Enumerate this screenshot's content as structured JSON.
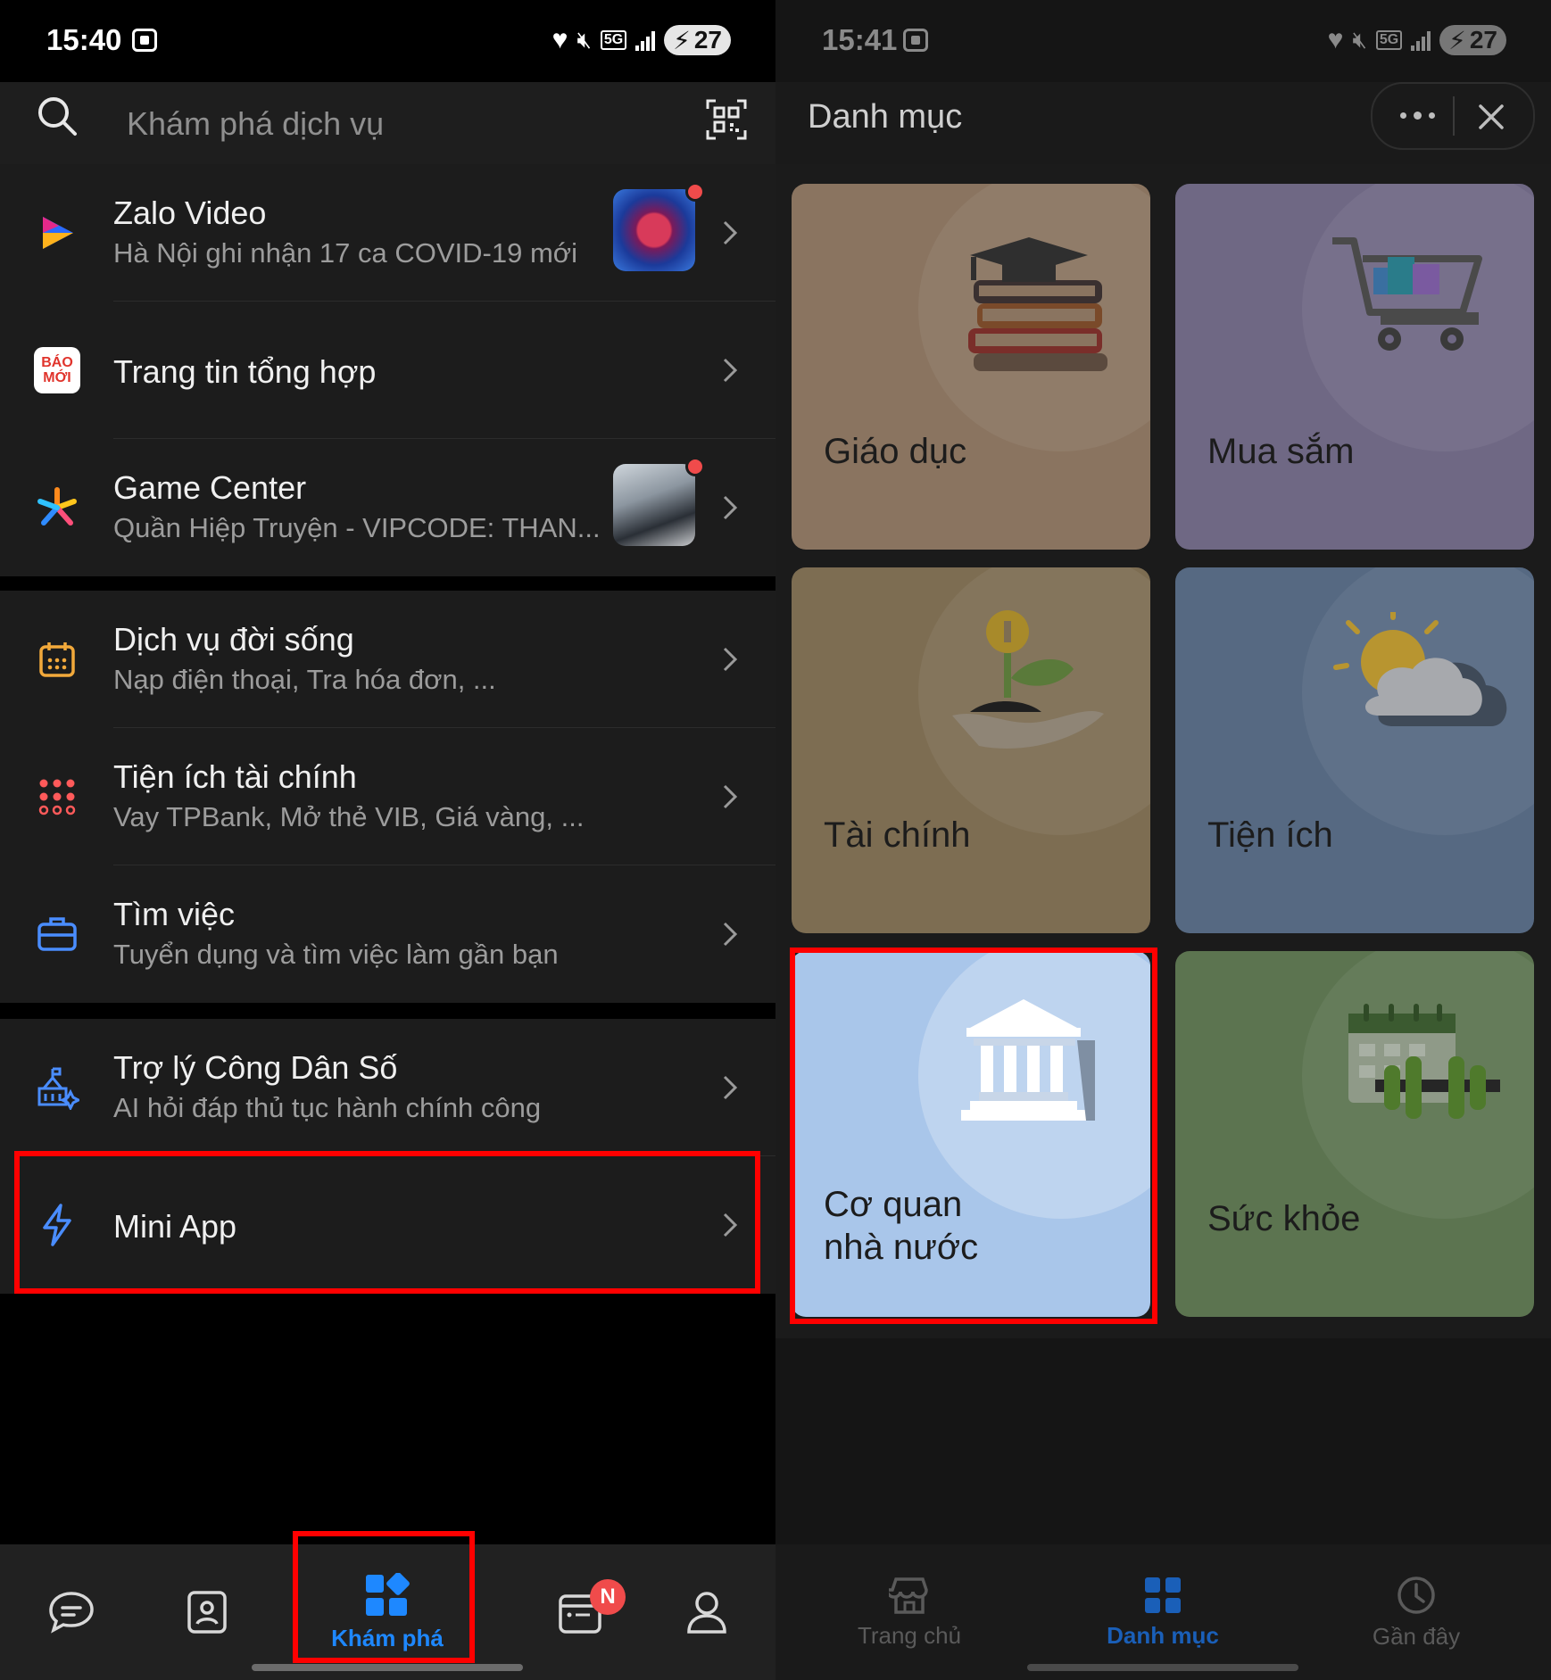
{
  "left_screen": {
    "status": {
      "time": "15:40",
      "battery": "27"
    },
    "search": {
      "placeholder": "Khám phá dịch vụ"
    },
    "items": [
      {
        "title": "Zalo Video",
        "subtitle": "Hà Nội ghi nhận 17 ca COVID-19 mới"
      },
      {
        "title": "Trang tin tổng hợp",
        "subtitle": ""
      },
      {
        "title": "Game Center",
        "subtitle": "Quần Hiệp Truyện - VIPCODE: THAN..."
      },
      {
        "title": "Dịch vụ đời sống",
        "subtitle": "Nạp điện thoại, Tra hóa đơn, ..."
      },
      {
        "title": "Tiện ích tài chính",
        "subtitle": "Vay TPBank, Mở thẻ VIB, Giá vàng, ..."
      },
      {
        "title": "Tìm việc",
        "subtitle": "Tuyển dụng và tìm việc làm gần bạn"
      },
      {
        "title": "Trợ lý Công Dân Số",
        "subtitle": "AI hỏi đáp thủ tục hành chính công"
      },
      {
        "title": "Mini App",
        "subtitle": ""
      }
    ],
    "baomoi_logo": [
      "BÁO",
      "MỚI"
    ],
    "bottom_nav": {
      "explore_label": "Khám phá",
      "badge": "N"
    }
  },
  "right_screen": {
    "status": {
      "time": "15:41",
      "battery": "27"
    },
    "header": {
      "title": "Danh mục"
    },
    "categories": [
      {
        "label": "Giáo dục",
        "color": "#8a7460"
      },
      {
        "label": "Mua sắm",
        "color": "#6f6884"
      },
      {
        "label": "Tài chính",
        "color": "#7d6d52"
      },
      {
        "label": "Tiện ích",
        "color": "#566982"
      },
      {
        "label": "Cơ quan",
        "label2": "nhà nước",
        "color": "#a9c6ea"
      },
      {
        "label": "Sức khỏe",
        "color": "#5c7450"
      }
    ],
    "bottom_nav": {
      "home_label": "Trang chủ",
      "category_label": "Danh mục",
      "recent_label": "Gần đây"
    }
  },
  "colors": {
    "accent": "#1e88ff",
    "highlight": "#ff0000",
    "badge": "#f04b4b"
  }
}
